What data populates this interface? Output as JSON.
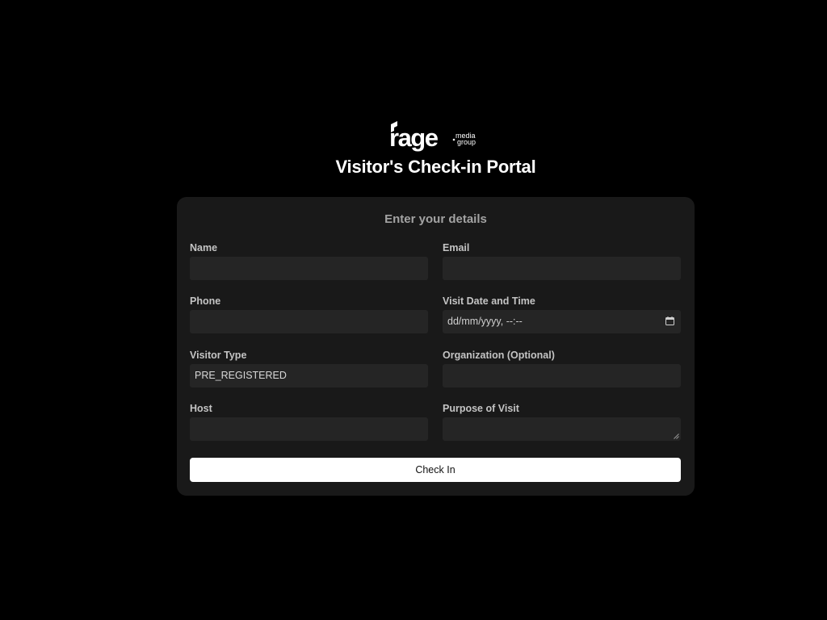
{
  "brand": {
    "logo_text": "rage",
    "logo_sub_1": "media",
    "logo_sub_2": "group"
  },
  "page": {
    "title": "Visitor's Check-in Portal"
  },
  "form": {
    "heading": "Enter your details",
    "fields": {
      "name": {
        "label": "Name",
        "value": ""
      },
      "email": {
        "label": "Email",
        "value": ""
      },
      "phone": {
        "label": "Phone",
        "value": ""
      },
      "visit_datetime": {
        "label": "Visit Date and Time",
        "placeholder": "dd/mm/yyyy, --:--"
      },
      "visitor_type": {
        "label": "Visitor Type",
        "value": "PRE_REGISTERED"
      },
      "organization": {
        "label": "Organization (Optional)",
        "value": ""
      },
      "host": {
        "label": "Host",
        "value": ""
      },
      "purpose": {
        "label": "Purpose of Visit",
        "value": ""
      }
    },
    "submit_label": "Check In"
  },
  "icons": {
    "calendar": "calendar-icon",
    "resize": "resize-grip-icon"
  },
  "colors": {
    "background": "#000000",
    "card": "#191919",
    "input": "#252525",
    "button": "#ffffff"
  }
}
